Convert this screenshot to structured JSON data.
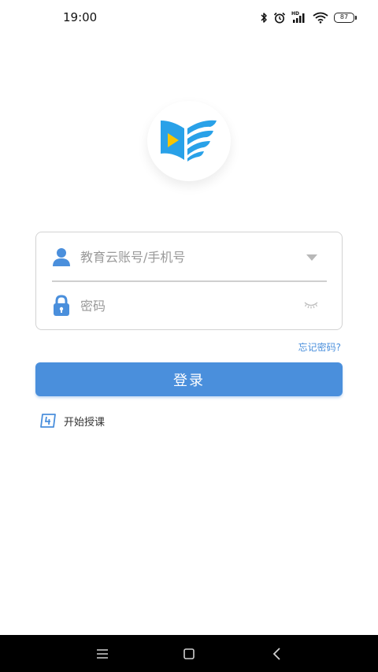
{
  "status_bar": {
    "time": "19:00",
    "hd_label": "HD",
    "battery_level": "87",
    "icons": [
      "bluetooth-icon",
      "alarm-icon",
      "signal-icon",
      "wifi-icon",
      "battery-icon"
    ]
  },
  "login": {
    "account_placeholder": "教育云账号/手机号",
    "password_placeholder": "密码",
    "forgot_password": "忘记密码?",
    "login_button": "登录",
    "start_teaching": "开始授课"
  },
  "colors": {
    "accent": "#4a8fdc",
    "logo_yellow": "#f7c500",
    "border": "#d3d3d3"
  },
  "nav_bar": {
    "icons": [
      "menu-icon",
      "home-icon",
      "back-icon"
    ]
  }
}
